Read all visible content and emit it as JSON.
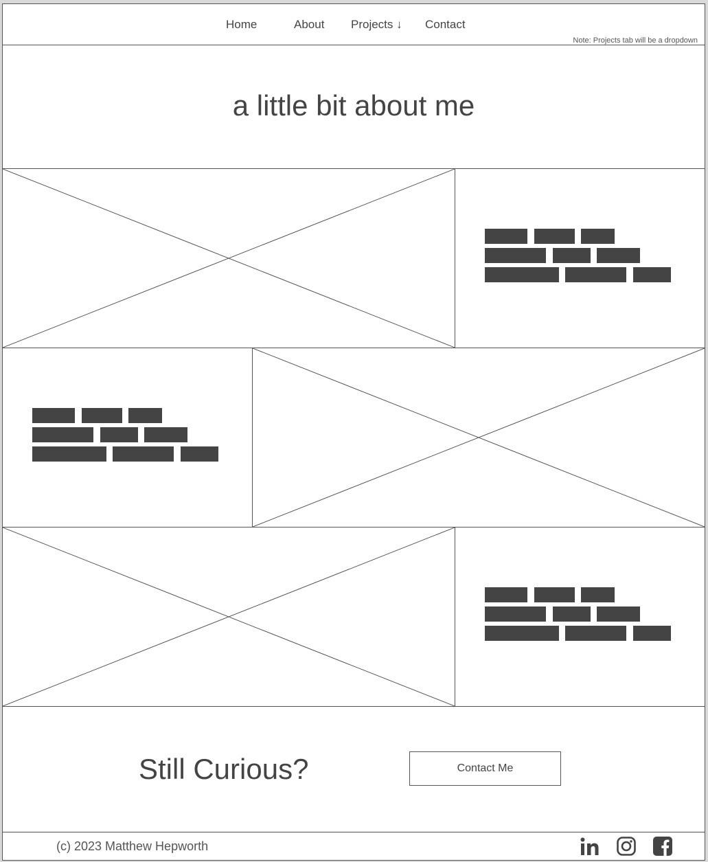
{
  "nav": {
    "links": [
      {
        "label": "Home"
      },
      {
        "label": "About"
      },
      {
        "label": "Projects ↓"
      },
      {
        "label": "Contact"
      }
    ],
    "note": "Note: Projects tab will be a dropdown"
  },
  "hero": {
    "title": "a little bit about me"
  },
  "cta": {
    "title": "Still Curious?",
    "button_label": "Contact Me"
  },
  "footer": {
    "copyright": "(c) 2023 Matthew Hepworth",
    "social_icons": [
      "linkedin-icon",
      "instagram-icon",
      "facebook-icon"
    ]
  },
  "colors": {
    "text": "#444444",
    "border": "#555555",
    "text_placeholder_bar": "#444444"
  }
}
